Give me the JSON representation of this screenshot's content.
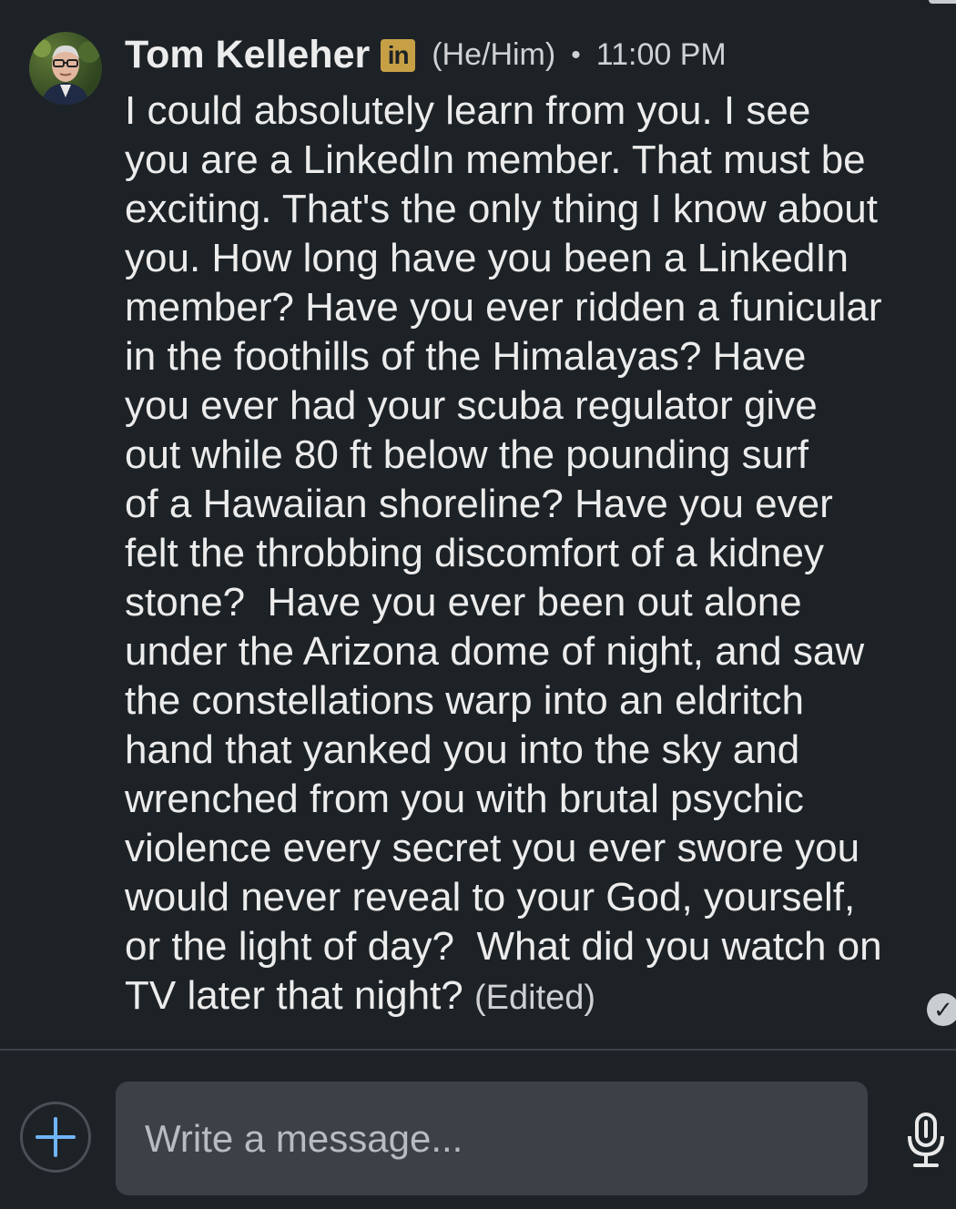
{
  "message": {
    "sender_name": "Tom Kelleher",
    "badge_text": "in",
    "pronouns": "(He/Him)",
    "separator": "•",
    "timestamp": "11:00 PM",
    "body_lines": [
      "I could absolutely learn from you. I see",
      "you are a LinkedIn member. That must be",
      "exciting. That's the only thing I know about",
      "you. How long have you been a LinkedIn",
      "member? Have you ever ridden a funicular",
      "in the foothills of the Himalayas? Have",
      "you ever had your scuba regulator give",
      "out while 80 ft below the pounding surf",
      "of a Hawaiian shoreline? Have you ever",
      "felt the throbbing discomfort of a kidney",
      "stone?  Have you ever been out alone",
      "under the Arizona dome of night, and saw",
      "the constellations warp into an eldritch",
      "hand that yanked you into the sky and",
      "wrenched from you with brutal psychic",
      "violence every secret you ever swore you",
      "would never reveal to your God, yourself,",
      "or the light of day?  What did you watch on",
      "TV later that night? "
    ],
    "edited_label": "(Edited)",
    "read_receipt_icon": "checkmark-icon"
  },
  "composer": {
    "placeholder": "Write a message...",
    "attach_icon": "plus-icon",
    "mic_icon": "microphone-icon"
  },
  "colors": {
    "background": "#1d2226",
    "input_background": "#3b4147",
    "badge_gold": "#c7a046",
    "attach_blue": "#70b5f9",
    "text": "#ececec",
    "muted_text": "#cfd1d3"
  }
}
